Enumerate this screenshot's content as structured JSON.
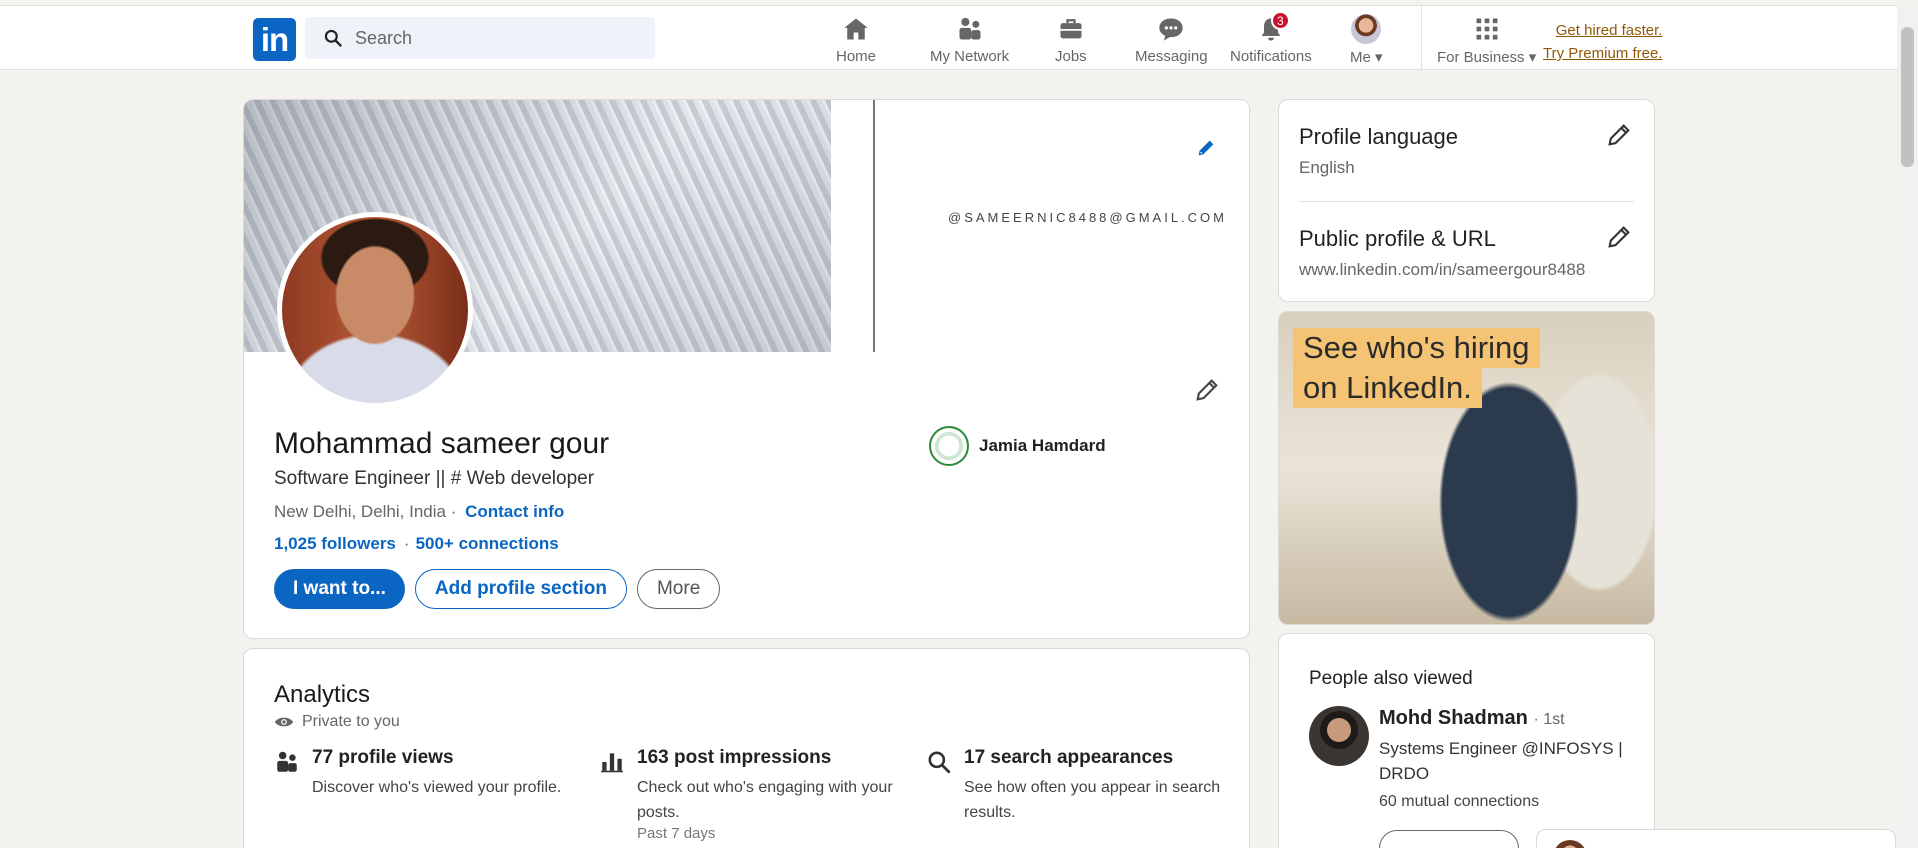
{
  "nav": {
    "logo": "in",
    "search_placeholder": "Search",
    "items": [
      {
        "label": "Home"
      },
      {
        "label": "My Network"
      },
      {
        "label": "Jobs"
      },
      {
        "label": "Messaging"
      },
      {
        "label": "Notifications",
        "badge": "3"
      },
      {
        "label": "Me"
      },
      {
        "label": "For Business"
      }
    ],
    "premium": {
      "line1": "Get hired faster.",
      "line2": "Try Premium free."
    }
  },
  "profile": {
    "cover_email": "@SAMEERNIC8488@GMAIL.COM",
    "name": "Mohammad sameer gour",
    "headline": "Software Engineer || # Web developer",
    "location": "New Delhi, Delhi, India ·",
    "contact_info": "Contact info",
    "followers": "1,025 followers",
    "connections": "500+ connections",
    "school": "Jamia Hamdard",
    "buttons": {
      "primary": "I want to...",
      "add_section": "Add profile section",
      "more": "More"
    }
  },
  "analytics": {
    "title": "Analytics",
    "private": "Private to you",
    "items": [
      {
        "title": "77 profile views",
        "desc": "Discover who's viewed your profile.",
        "extra": ""
      },
      {
        "title": "163 post impressions",
        "desc": "Check out who's engaging with your posts.",
        "extra": "Past 7 days"
      },
      {
        "title": "17 search appearances",
        "desc": "See how often you appear in search results.",
        "extra": ""
      }
    ]
  },
  "sidebar": {
    "language_title": "Profile language",
    "language_value": "English",
    "url_title": "Public profile & URL",
    "url_value": "www.linkedin.com/in/sameergour8488",
    "ad_line1": "See who's hiring",
    "ad_line2": "on LinkedIn.",
    "people_title": "People also viewed",
    "person": {
      "name": "Mohd Shadman",
      "degree": "· 1st",
      "headline": "Systems Engineer @INFOSYS | DRDO",
      "mutual": "60 mutual connections"
    }
  },
  "colors": {
    "brand": "#0a66c2",
    "badge": "#cb112d",
    "premium": "#915907"
  }
}
